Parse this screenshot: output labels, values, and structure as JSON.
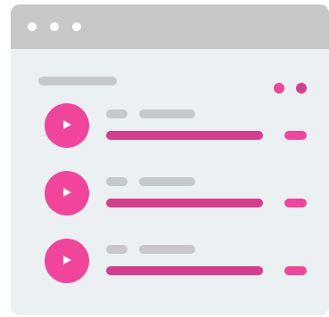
{
  "colors": {
    "titlebar": "#c6c8c9",
    "window_bg": "#ebf0f3",
    "accent": "#f0459a",
    "accent_dark": "#d63d8b",
    "placeholder": "#c6c8c9"
  },
  "titlebar": {
    "dots": [
      "window-dot-1",
      "window-dot-2",
      "window-dot-3"
    ]
  },
  "menu": {
    "icon": "more-dots-icon"
  },
  "tracks": [
    {
      "icon": "play-icon",
      "progress": 1.0
    },
    {
      "icon": "play-icon",
      "progress": 1.0
    },
    {
      "icon": "play-icon",
      "progress": 1.0
    }
  ]
}
